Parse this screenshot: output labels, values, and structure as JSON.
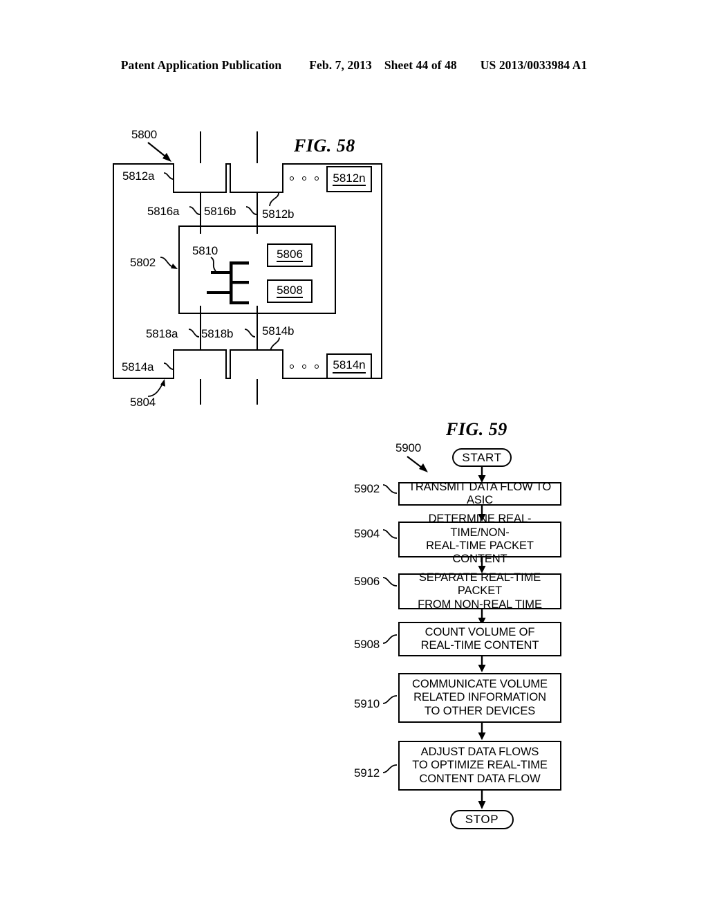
{
  "header": {
    "publication": "Patent Application Publication",
    "date": "Feb. 7, 2013",
    "sheet": "Sheet 44 of 48",
    "patent_number": "US 2013/0033984 A1"
  },
  "fig58": {
    "title": "FIG. 58",
    "refs": {
      "device": "5800",
      "inner_block": "5802",
      "outer_frame": "5804",
      "box_5806": "5806",
      "box_5808": "5808",
      "glyph_5810": "5810",
      "top_port_a": "5812a",
      "top_port_b": "5812b",
      "top_port_n": "5812n",
      "bottom_port_a": "5814a",
      "bottom_port_b": "5814b",
      "bottom_port_n": "5814n",
      "top_line_a": "5816a",
      "top_line_b": "5816b",
      "bottom_line_a": "5818a",
      "bottom_line_b": "5818b"
    }
  },
  "fig59": {
    "title": "FIG. 59",
    "flow_ref": "5900",
    "start_label": "START",
    "stop_label": "STOP",
    "steps": [
      {
        "ref": "5902",
        "lines": [
          "TRANSMIT DATA FLOW TO ASIC"
        ]
      },
      {
        "ref": "5904",
        "lines": [
          "DETERMINE REAL-TIME/NON-",
          "REAL-TIME PACKET CONTENT"
        ]
      },
      {
        "ref": "5906",
        "lines": [
          "SEPARATE REAL-TIME PACKET",
          "FROM NON-REAL TIME"
        ]
      },
      {
        "ref": "5908",
        "lines": [
          "COUNT VOLUME OF",
          "REAL-TIME CONTENT"
        ]
      },
      {
        "ref": "5910",
        "lines": [
          "COMMUNICATE VOLUME",
          "RELATED INFORMATION",
          "TO OTHER DEVICES"
        ]
      },
      {
        "ref": "5912",
        "lines": [
          "ADJUST DATA FLOWS",
          "TO OPTIMIZE REAL-TIME",
          "CONTENT DATA FLOW"
        ]
      }
    ]
  },
  "colors": {
    "ink": "#000000",
    "paper": "#ffffff"
  }
}
